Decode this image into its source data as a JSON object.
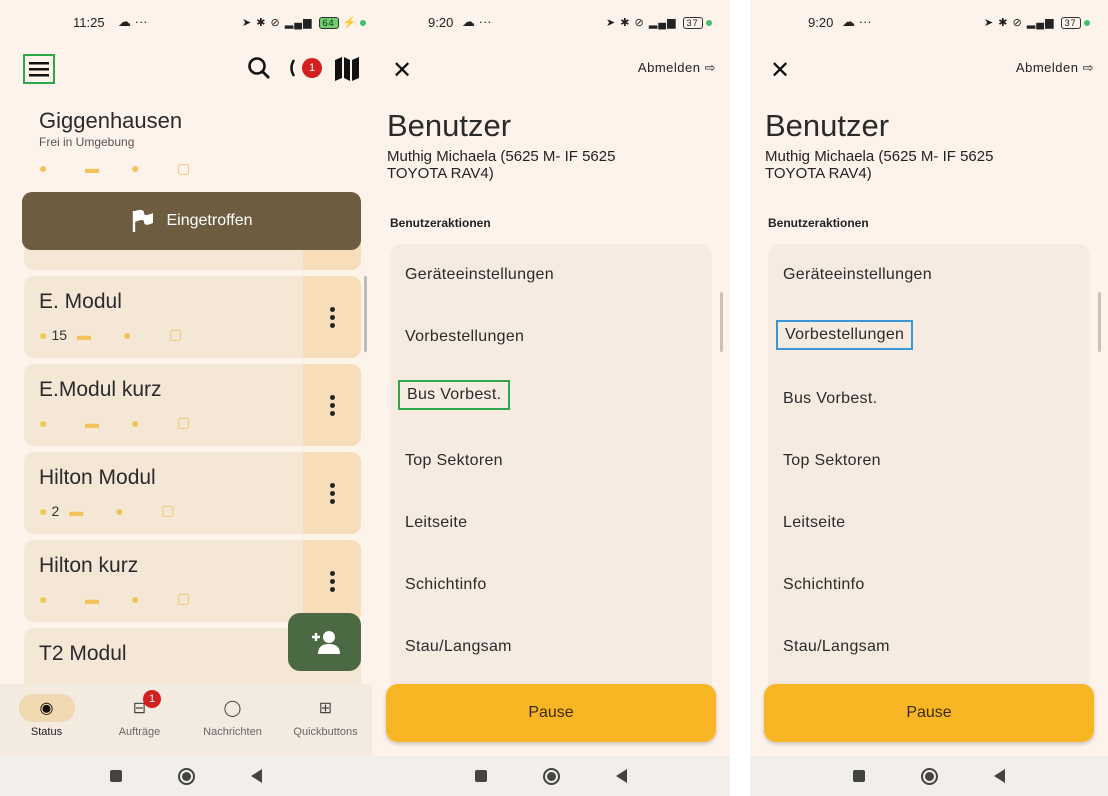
{
  "screen1": {
    "status_time": "11:25",
    "battery": "64",
    "notification_badge": "1",
    "station": {
      "title": "Giggenhausen",
      "subtitle": "Frei in Umgebung"
    },
    "arrived_label": "Eingetroffen",
    "cards": [
      {
        "title": "E. Modul",
        "count1": "15",
        "count2": ""
      },
      {
        "title": "E.Modul kurz",
        "count1": "",
        "count2": ""
      },
      {
        "title": "Hilton Modul",
        "count1": "2",
        "count2": ""
      },
      {
        "title": "Hilton kurz",
        "count1": "",
        "count2": ""
      },
      {
        "title": "T2 Modul",
        "count1": "",
        "count2": ""
      }
    ],
    "nav": [
      {
        "label": "Status",
        "badge": ""
      },
      {
        "label": "Aufträge",
        "badge": "1"
      },
      {
        "label": "Nachrichten",
        "badge": ""
      },
      {
        "label": "Quickbuttons",
        "badge": ""
      }
    ]
  },
  "user_screen": {
    "status_time": "9:20",
    "battery": "37",
    "logout_label": "Abmelden",
    "heading": "Benutzer",
    "subheading": "Muthig Michaela (5625 M- IF 5625 TOYOTA RAV4)",
    "section_label": "Benutzeraktionen",
    "actions": [
      "Geräteeinstellungen",
      "Vorbestellungen",
      "Bus Vorbest.",
      "Top Sektoren",
      "Leitseite",
      "Schichtinfo",
      "Stau/Langsam"
    ],
    "pause_label": "Pause"
  },
  "colors": {
    "accent_green": "#2ca84a",
    "accent_blue": "#3a96d6",
    "pause_yellow": "#f9b624",
    "arrived_brown": "#6d5c3f"
  }
}
